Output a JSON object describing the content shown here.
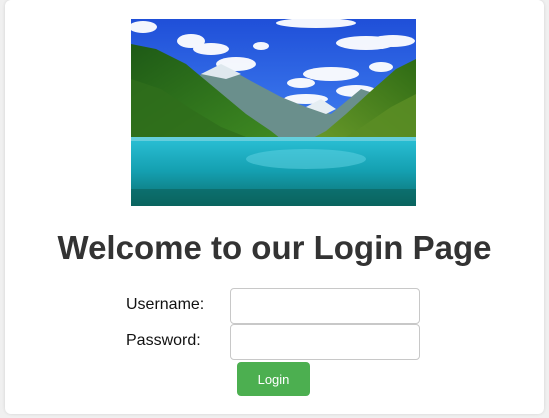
{
  "page": {
    "title": "Welcome to our Login Page"
  },
  "hero_image": {
    "icon": "lake-mountain-landscape-image"
  },
  "form": {
    "username_label": "Username:",
    "username_value": "",
    "password_label": "Password:",
    "password_value": "",
    "login_label": "Login"
  },
  "colors": {
    "login_button": "#4caf50",
    "title_text": "#333333"
  }
}
